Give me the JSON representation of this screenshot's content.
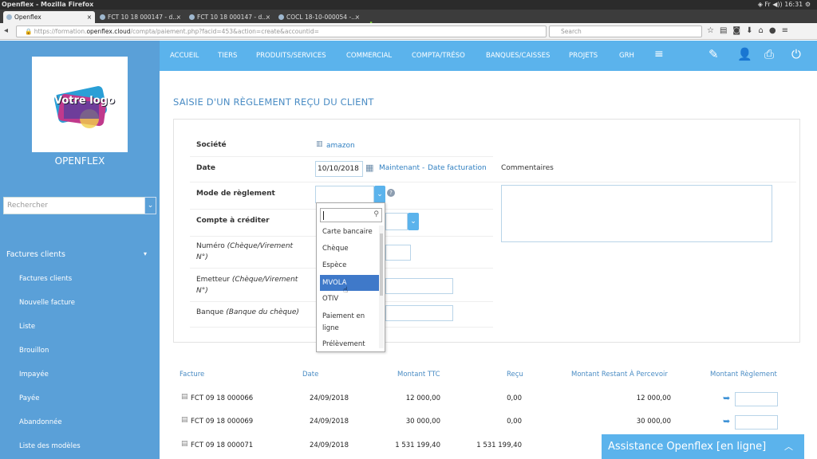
{
  "os": {
    "window_title": "Openflex - Mozilla Firefox",
    "clock": "16:31",
    "lang": "Fr"
  },
  "browser": {
    "tabs": [
      {
        "label": "Openflex"
      },
      {
        "label": "FCT 10 18 000147 - d..."
      },
      {
        "label": "FCT 10 18 000147 - d..."
      },
      {
        "label": "COCL 18-10-000054 -..."
      }
    ],
    "url_prefix": "https://formation.",
    "url_host": "openflex.cloud",
    "url_path": "/compta/paiement.php?facid=453&action=create&accountid=",
    "search_placeholder": "Search"
  },
  "sidebar": {
    "logo_text": "Votre logo",
    "brand": "OPENFLEX",
    "search_placeholder": "Rechercher",
    "section": "Factures clients",
    "items": [
      {
        "label": "Factures clients"
      },
      {
        "label": "Nouvelle facture"
      },
      {
        "label": "Liste"
      },
      {
        "label": "Brouillon"
      },
      {
        "label": "Impayée"
      },
      {
        "label": "Payée"
      },
      {
        "label": "Abandonnée"
      },
      {
        "label": "Liste des modèles"
      }
    ]
  },
  "topnav": {
    "items": [
      {
        "label": "ACCUEIL"
      },
      {
        "label": "TIERS"
      },
      {
        "label": "PRODUITS/SERVICES"
      },
      {
        "label": "COMMERCIAL"
      },
      {
        "label": "COMPTA/TRÉSO"
      },
      {
        "label": "BANQUES/CAISSES"
      },
      {
        "label": "PROJETS"
      },
      {
        "label": "GRH"
      }
    ]
  },
  "page": {
    "title": "SAISIE D'UN RÈGLEMENT REÇU DU CLIENT"
  },
  "form": {
    "societe_label": "Société",
    "societe_value": "amazon",
    "date_label": "Date",
    "date_value": "10/10/2018",
    "maintenant_link": "Maintenant",
    "date_sep": "-",
    "date_facturation_link": "Date facturation",
    "commentaires_label": "Commentaires",
    "mode_label": "Mode de règlement",
    "compte_label": "Compte à créditer",
    "numero_label": "Numéro",
    "numero_hint": "(Chèque/Virement N°)",
    "emetteur_label": "Emetteur",
    "emetteur_hint": "(Chèque/Virement N°)",
    "banque_label": "Banque",
    "banque_hint": "(Banque du chèque)"
  },
  "dropdown": {
    "search_value": "",
    "options": [
      {
        "label": "Carte bancaire"
      },
      {
        "label": "Chèque"
      },
      {
        "label": "Espèce"
      },
      {
        "label": "MVOLA"
      },
      {
        "label": "OTIV"
      },
      {
        "label": "Paiement en ligne"
      },
      {
        "label": "Prélèvement"
      }
    ],
    "highlighted": "MVOLA"
  },
  "table": {
    "headers": {
      "facture": "Facture",
      "date": "Date",
      "montant_ttc": "Montant TTC",
      "recu": "Reçu",
      "restant": "Montant Restant À Percevoir",
      "reglement": "Montant Règlement"
    },
    "rows": [
      {
        "facture": "FCT 09 18 000066",
        "date": "24/09/2018",
        "montant_ttc": "12 000,00",
        "recu": "0,00",
        "restant": "12 000,00"
      },
      {
        "facture": "FCT 09 18 000069",
        "date": "24/09/2018",
        "montant_ttc": "30 000,00",
        "recu": "0,00",
        "restant": "30 000,00"
      },
      {
        "facture": "FCT 09 18 000071",
        "date": "24/09/2018",
        "montant_ttc": "1 531 199,40",
        "recu": "1 531 199,40",
        "restant": ""
      }
    ]
  },
  "chat": {
    "label": "Assistance Openflex [en ligne]"
  }
}
